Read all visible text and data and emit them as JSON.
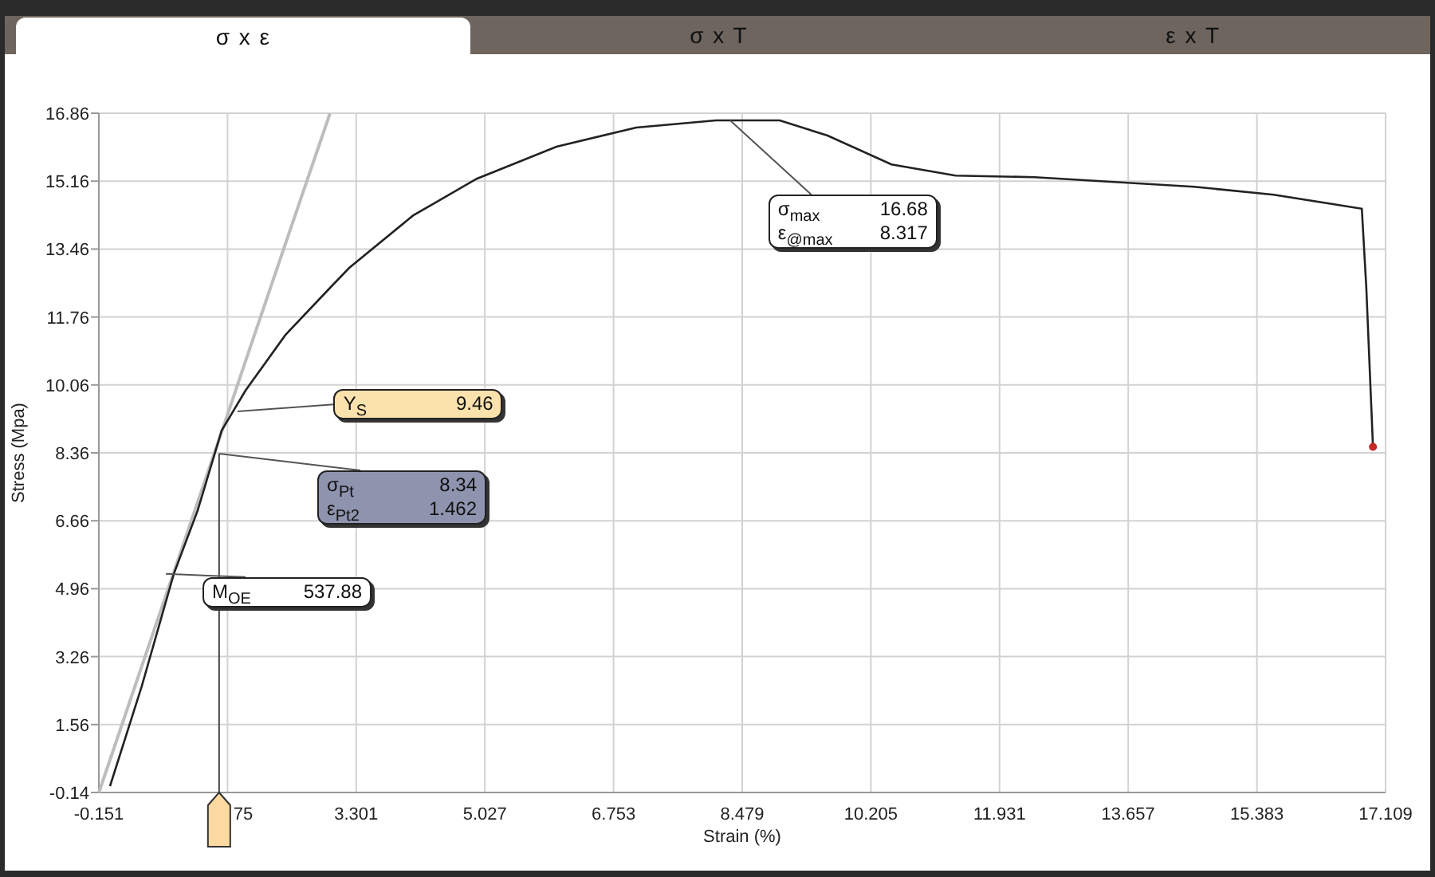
{
  "tabs": [
    {
      "label": "σ x ε",
      "selected": true
    },
    {
      "label": "σ x T",
      "selected": false
    },
    {
      "label": "ε x T",
      "selected": false
    }
  ],
  "chart_data": {
    "type": "line",
    "xlabel": "Strain (%)",
    "ylabel": "Stress (Mpa)",
    "x": [
      -0.151,
      -0.001,
      0.427,
      0.854,
      1.175,
      1.495,
      1.816,
      2.351,
      2.95,
      3.206,
      4.062,
      4.918,
      5.987,
      7.057,
      8.126,
      8.982,
      9.624,
      10.48,
      11.34,
      12.4,
      13.47,
      14.54,
      15.61,
      16.79,
      16.85,
      16.94
    ],
    "series": [
      {
        "color": "#222222",
        "values": [
          null,
          0.02,
          2.53,
          5.33,
          6.92,
          8.92,
          9.92,
          11.31,
          12.49,
          12.99,
          14.3,
          15.22,
          16.02,
          16.5,
          16.68,
          16.68,
          16.3,
          15.58,
          15.3,
          15.26,
          15.14,
          15.02,
          14.82,
          14.47,
          12.51,
          8.51
        ]
      },
      {
        "color": "#bdbdbd",
        "values": [
          -0.14,
          0.68,
          3.03,
          5.37,
          7.13,
          8.88,
          10.66,
          13.59,
          16.86,
          null,
          null,
          null,
          null,
          null,
          null,
          null,
          null,
          null,
          null,
          null,
          null,
          null,
          null,
          null,
          null,
          null
        ]
      }
    ],
    "grid": true,
    "xlim": [
      -0.151,
      17.109
    ],
    "ylim": [
      -0.14,
      16.86
    ],
    "xticks": [
      -0.151,
      3.301,
      5.027,
      6.753,
      8.479,
      10.205,
      11.931,
      13.657,
      15.383,
      17.109
    ],
    "yticks": [
      -0.14,
      1.56,
      3.26,
      4.96,
      6.66,
      8.36,
      10.06,
      11.76,
      13.46,
      15.16,
      16.86
    ]
  },
  "covered_tick_label": "75",
  "callouts": [
    {
      "color": "#ffffff",
      "rows": [
        {
          "label": "σ$_{max}$",
          "value": "16.68"
        },
        {
          "label": "ε$_{@max}$",
          "value": "8.317"
        }
      ]
    },
    {
      "color": "#fbe2ad",
      "rows": [
        {
          "label": "Y$_{S}$",
          "value": "9.46"
        }
      ]
    },
    {
      "color": "#8e93ae",
      "rows": [
        {
          "label": "σ$_{Pt}$",
          "value": "8.34"
        },
        {
          "label": "ε$_{Pt2}$",
          "value": "1.462"
        }
      ]
    },
    {
      "color": "#ffffff",
      "rows": [
        {
          "label": "M$_{OE}$",
          "value": "537.88"
        }
      ]
    }
  ]
}
